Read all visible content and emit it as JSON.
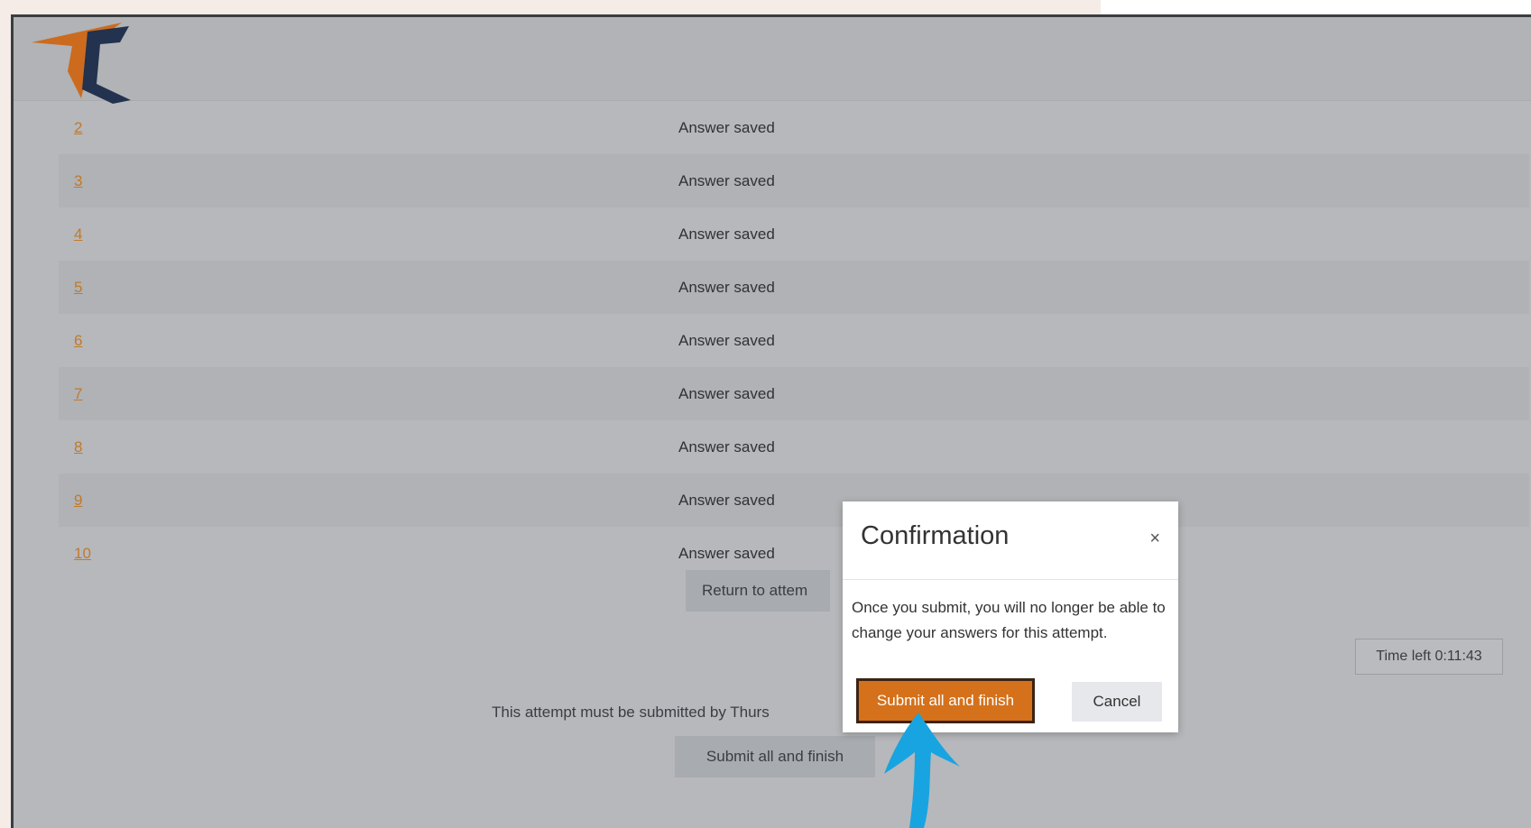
{
  "rows": [
    {
      "num": "2",
      "status": "Answer saved"
    },
    {
      "num": "3",
      "status": "Answer saved"
    },
    {
      "num": "4",
      "status": "Answer saved"
    },
    {
      "num": "5",
      "status": "Answer saved"
    },
    {
      "num": "6",
      "status": "Answer saved"
    },
    {
      "num": "7",
      "status": "Answer saved"
    },
    {
      "num": "8",
      "status": "Answer saved"
    },
    {
      "num": "9",
      "status": "Answer saved"
    },
    {
      "num": "10",
      "status": "Answer saved"
    }
  ],
  "return_button": "Return to attem",
  "time_left": "Time left 0:11:43",
  "deadline_text": "This attempt must be submitted by Thurs",
  "submit_button_bg": "Submit all and finish",
  "modal": {
    "title": "Confirmation",
    "close": "×",
    "body": "Once you submit, you will no longer be able to change your answers for this attempt.",
    "submit": "Submit all and finish",
    "cancel": "Cancel"
  },
  "colors": {
    "accent": "#d5711b",
    "arrow": "#18a4e0",
    "logo_orange": "#cc6b1e",
    "logo_navy": "#22324f"
  }
}
